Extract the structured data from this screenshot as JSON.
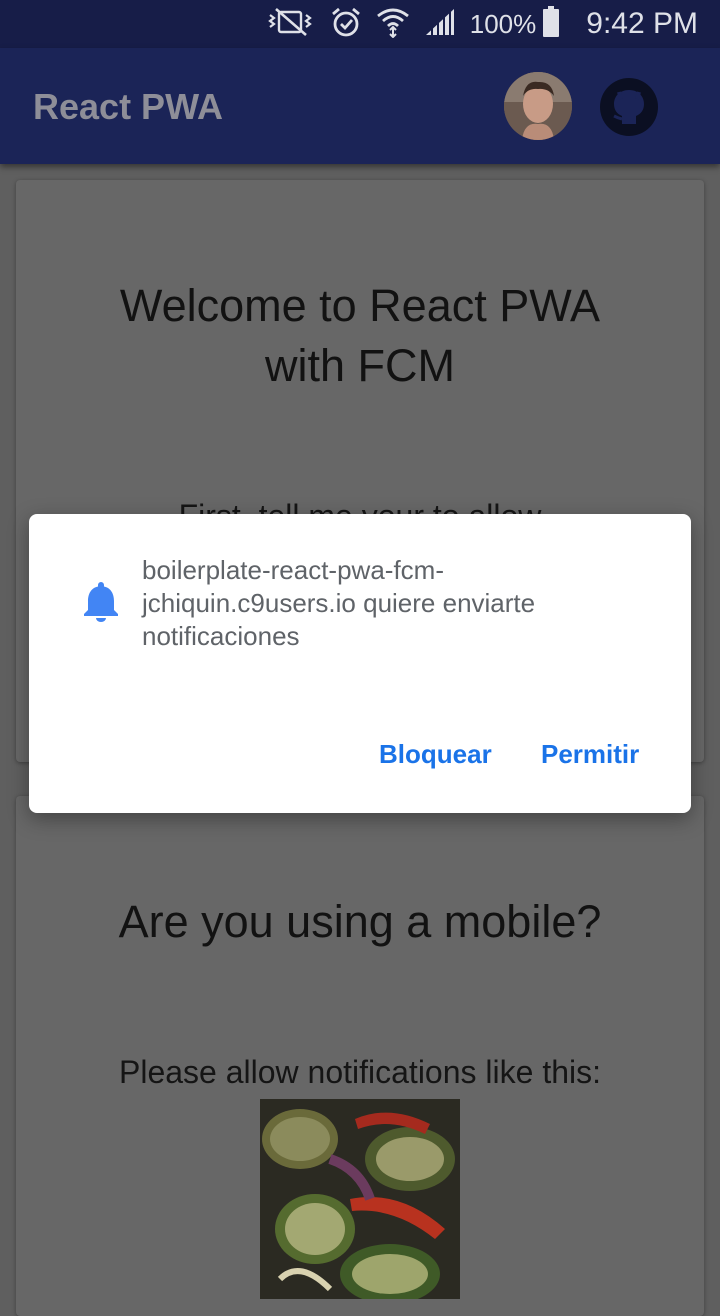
{
  "status_bar": {
    "battery_percent": "100%",
    "time": "9:42 PM",
    "icons": [
      "mute-vibrate-icon",
      "alarm-icon",
      "wifi-icon",
      "signal-icon",
      "battery-icon"
    ]
  },
  "app_bar": {
    "title": "React PWA",
    "icons": [
      "avatar",
      "github-icon"
    ]
  },
  "cards": {
    "welcome": {
      "title_line1": "Welcome to React PWA",
      "title_line2": "with FCM",
      "partial_text": "First, tell me your to allow"
    },
    "mobile": {
      "title": "Are you using a mobile?",
      "body": "Please allow notifications like this:"
    }
  },
  "dialog": {
    "message_line1": "boilerplate-react-pwa-fcm-",
    "message_line2": "jchiquin.c9users.io quiere enviarte",
    "message_line3": "notificaciones",
    "block_label": "Bloquear",
    "allow_label": "Permitir",
    "icon": "bell-icon"
  },
  "colors": {
    "status_bar": "#171d48",
    "app_bar": "#1b2457",
    "accent": "#1a73e8",
    "scrim": "#5f5f5f"
  }
}
